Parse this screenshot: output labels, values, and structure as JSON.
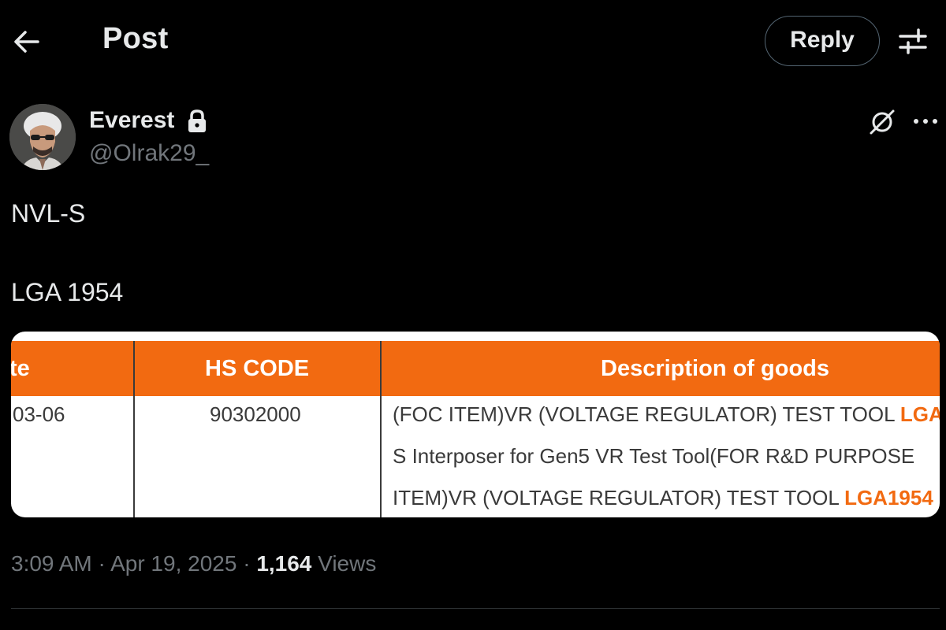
{
  "header": {
    "title": "Post",
    "reply_label": "Reply",
    "back_icon": "arrow-left-icon",
    "filter_icon": "sliders-icon"
  },
  "author": {
    "display_name": "Everest",
    "handle": "@Olrak29_",
    "protected_icon": "lock-icon"
  },
  "actions": {
    "grok_icon": "grok-icon",
    "more_icon": "more-horizontal-icon"
  },
  "post": {
    "line1": "NVL-S",
    "line2": "LGA 1954"
  },
  "media": {
    "columns": [
      "te",
      "HS CODE",
      "Description of goods"
    ],
    "row": {
      "date": "03-06",
      "hs_code": "90302000",
      "desc_lines": [
        {
          "text": "(FOC ITEM)VR (VOLTAGE REGULATOR) TEST TOOL ",
          "highlight": "LGA"
        },
        {
          "text": "S Interposer for Gen5 VR Test Tool(FOR R&D PURPOSE",
          "highlight": ""
        },
        {
          "text": "ITEM)VR (VOLTAGE REGULATOR) TEST TOOL ",
          "highlight": "LGA1954"
        }
      ]
    },
    "header_color": "#f26a11"
  },
  "meta": {
    "time": "3:09 AM",
    "sep1": " · ",
    "date": "Apr 19, 2025",
    "sep2": " · ",
    "views_count": "1,164",
    "views_label": " Views"
  },
  "colors": {
    "background": "#000000",
    "text_primary": "#e7e9ea",
    "text_secondary": "#71767b",
    "accent_orange": "#f26a11"
  }
}
